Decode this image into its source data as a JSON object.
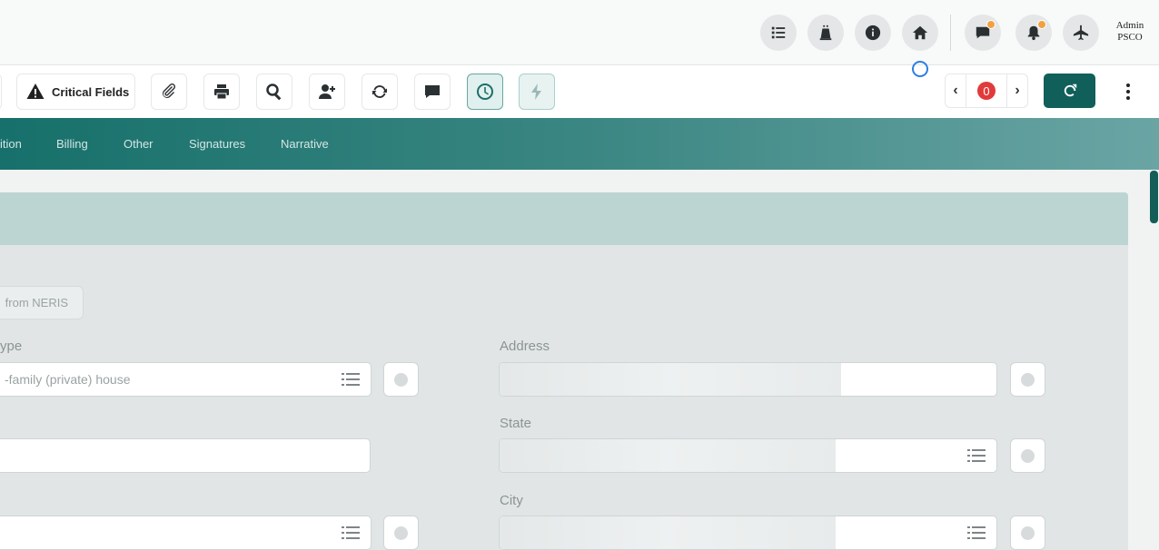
{
  "header": {
    "user_name": "Admin",
    "user_org": "PSCO",
    "icons": [
      "list-icon",
      "lighthouse-icon",
      "info-icon",
      "home-icon",
      "chat-icon",
      "bell-icon",
      "plane-icon"
    ]
  },
  "toolbar": {
    "critical_fields_label": "Critical Fields",
    "pager_count": "0",
    "prev_label": "‹",
    "next_label": "›"
  },
  "tabs": [
    {
      "label": "ition"
    },
    {
      "label": "Billing"
    },
    {
      "label": "Other"
    },
    {
      "label": "Signatures"
    },
    {
      "label": "Narrative"
    }
  ],
  "form": {
    "neris_button_label": "from NERIS",
    "left_fields": [
      {
        "label": "ype",
        "value": "-family (private) house"
      },
      {
        "label": "",
        "value": ""
      },
      {
        "label": "",
        "value": ""
      }
    ],
    "right_fields": [
      {
        "label": "Address",
        "value": ""
      },
      {
        "label": "State",
        "value": ""
      },
      {
        "label": "City",
        "value": ""
      }
    ]
  },
  "colors": {
    "accent": "#105f5a",
    "tab_gradient_start": "#17706b",
    "tab_gradient_end": "#6aa5a4",
    "badge_red": "#e23a3a",
    "notification_orange": "#f0a243"
  }
}
